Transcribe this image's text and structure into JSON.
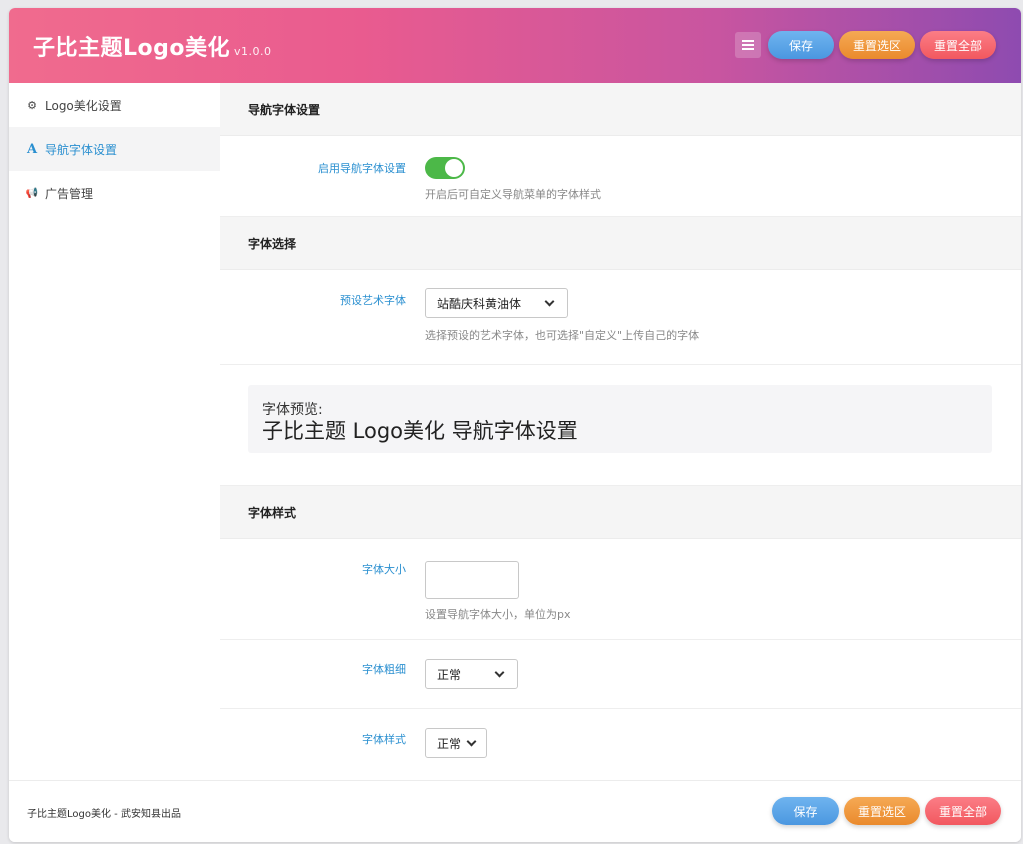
{
  "header": {
    "title": "子比主题Logo美化",
    "version": "v1.0.0",
    "save_label": "保存",
    "reset_section_label": "重置选区",
    "reset_all_label": "重置全部"
  },
  "sidebar": {
    "items": [
      {
        "label": "Logo美化设置",
        "icon": "gear-icon",
        "glyph": "⚙"
      },
      {
        "label": "导航字体设置",
        "icon": "font-icon",
        "glyph": "A"
      },
      {
        "label": "广告管理",
        "icon": "megaphone-icon",
        "glyph": "📢"
      }
    ]
  },
  "sections": {
    "nav_font": {
      "title": "导航字体设置",
      "enable_label": "启用导航字体设置",
      "enable_desc": "开启后可自定义导航菜单的字体样式",
      "enabled": true
    },
    "font_select": {
      "title": "字体选择",
      "preset_label": "预设艺术字体",
      "preset_value": "站酷庆科黄油体",
      "preset_desc": "选择预设的艺术字体，也可选择\"自定义\"上传自己的字体",
      "preview_label": "字体预览:",
      "preview_text": "子比主题 Logo美化 导航字体设置"
    },
    "font_style": {
      "title": "字体样式",
      "size_label": "字体大小",
      "size_value": "",
      "size_desc": "设置导航字体大小，单位为px",
      "weight_label": "字体粗细",
      "weight_value": "正常",
      "style_label": "字体样式",
      "style_value": "正常"
    }
  },
  "footer": {
    "credit": "子比主题Logo美化 - 武安知县出品",
    "save_label": "保存",
    "reset_section_label": "重置选区",
    "reset_all_label": "重置全部"
  },
  "colors": {
    "accent": "#2a8fd0",
    "toggle_on": "#4cb848",
    "save": "#4b97e0",
    "reset_section": "#ea8a2d",
    "reset_all": "#f2585f"
  }
}
